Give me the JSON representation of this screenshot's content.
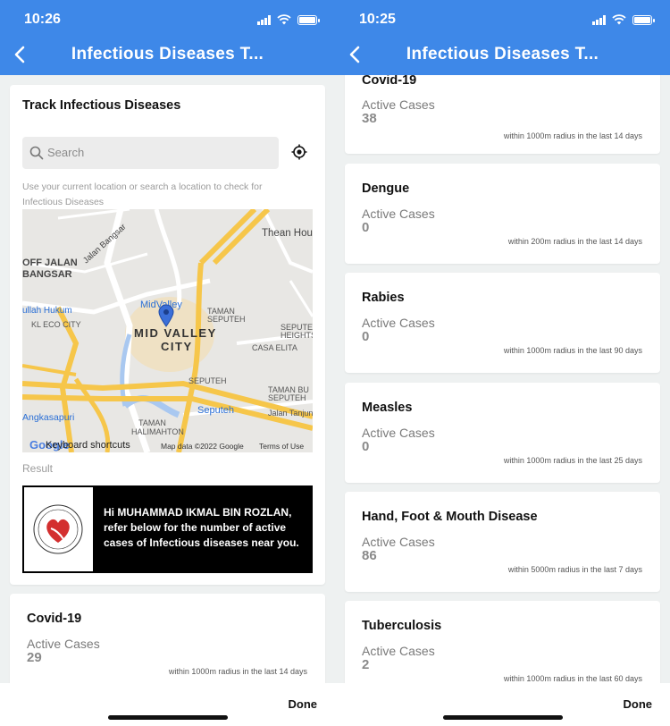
{
  "colors": {
    "header": "#3e88e8",
    "background": "#eef1f1",
    "card": "#ffffff",
    "banner": "#000000"
  },
  "left": {
    "time": "10:26",
    "title": "Infectious Diseases T...",
    "track": {
      "title": "Track Infectious Diseases",
      "search_placeholder": "Search",
      "hint": "Use your current location or search a location to check for Infectious Diseases"
    },
    "map": {
      "labels": {
        "thean_hou": "Thean Hou",
        "off_jalan": "OFF JALAN",
        "bangsar": "BANGSAR",
        "jalan_bangsar": "Jalan Bangsar",
        "ullah_hukum": "ullah Hukum",
        "mid_valley_station": "MidValley",
        "taman_seputeh": "TAMAN",
        "seputeh": "SEPUTEH",
        "kl_eco_city": "KL ECO CITY",
        "mid_valley": "MID VALLEY",
        "city": "CITY",
        "seputeh_heights_1": "SEPUTEH",
        "seputeh_heights_2": "HEIGHTS",
        "casa_elita": "CASA ELITA",
        "seputeh_road": "SEPUTEH",
        "taman_bu": "TAMAN BU",
        "seputeh_2": "SEPUTEH",
        "seputeh_station": "Seputeh",
        "jalan_tanjun": "Jalan Tanjun",
        "angkasapuri": "Angkasapuri",
        "taman_halimahton_1": "TAMAN",
        "taman_halimahton_2": "HALIMAHTON",
        "google": "Google"
      },
      "keyboard_shortcuts": "Keyboard shortcuts",
      "map_data": "Map data ©2022 Google",
      "terms": "Terms of Use"
    },
    "result_label": "Result",
    "banner_text": "Hi MUHAMMAD IKMAL BIN ROZLAN, refer below for the number of active cases of Infectious diseases near you.",
    "covid": {
      "name": "Covid-19",
      "label": "Active Cases",
      "count": "29",
      "radius": "within 1000m radius in the last 14 days"
    },
    "done": "Done"
  },
  "right": {
    "time": "10:25",
    "title": "Infectious Diseases T...",
    "diseases": [
      {
        "name": "Covid-19",
        "label": "Active Cases",
        "count": "38",
        "radius": "within 1000m radius in the last 14 days"
      },
      {
        "name": "Dengue",
        "label": "Active Cases",
        "count": "0",
        "radius": "within 200m radius in the last 14 days"
      },
      {
        "name": "Rabies",
        "label": "Active Cases",
        "count": "0",
        "radius": "within 1000m radius in the last 90 days"
      },
      {
        "name": "Measles",
        "label": "Active Cases",
        "count": "0",
        "radius": "within 1000m radius in the last 25 days"
      },
      {
        "name": "Hand, Foot & Mouth Disease",
        "label": "Active Cases",
        "count": "86",
        "radius": "within 5000m radius in the last 7 days"
      },
      {
        "name": "Tuberculosis",
        "label": "Active Cases",
        "count": "2",
        "radius": "within 1000m radius in the last 60 days"
      }
    ],
    "done": "Done"
  }
}
